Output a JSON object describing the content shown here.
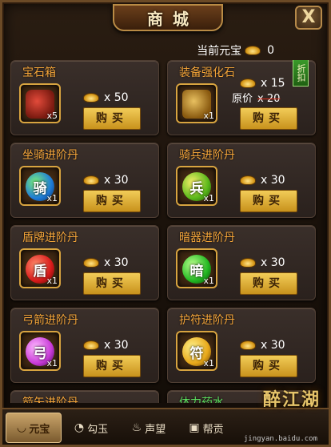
{
  "header": {
    "title": "商城",
    "close_label": "X"
  },
  "currency": {
    "label": "当前元宝",
    "value": "0"
  },
  "buy_label": "购买",
  "items": [
    {
      "name": "宝石箱",
      "orb_char": "",
      "qty": "x5",
      "price": "x 50",
      "name_color": "orange"
    },
    {
      "name": "装备强化石",
      "orb_char": "",
      "qty": "x1",
      "price": "x 15",
      "original_price_label": "原价",
      "original_price": "x 20",
      "discount_tag": "折扣",
      "name_color": "orange"
    },
    {
      "name": "坐骑进阶丹",
      "orb_char": "骑",
      "qty": "x1",
      "price": "x 30",
      "name_color": "orange"
    },
    {
      "name": "骑兵进阶丹",
      "orb_char": "兵",
      "qty": "x1",
      "price": "x 30",
      "name_color": "orange"
    },
    {
      "name": "盾牌进阶丹",
      "orb_char": "盾",
      "qty": "x1",
      "price": "x 30",
      "name_color": "orange"
    },
    {
      "name": "暗器进阶丹",
      "orb_char": "暗",
      "qty": "x1",
      "price": "x 30",
      "name_color": "orange"
    },
    {
      "name": "弓箭进阶丹",
      "orb_char": "弓",
      "qty": "x1",
      "price": "x 30",
      "name_color": "orange"
    },
    {
      "name": "护符进阶丹",
      "orb_char": "符",
      "qty": "x1",
      "price": "x 30",
      "name_color": "orange"
    },
    {
      "name": "箭矢进阶丹",
      "name_color": "orange"
    },
    {
      "name": "体力药水",
      "name_color": "green"
    }
  ],
  "tabs": [
    {
      "label": "元宝",
      "icon": "ingot-icon",
      "glyph": "◡"
    },
    {
      "label": "勾玉",
      "icon": "jade-icon",
      "glyph": "◔"
    },
    {
      "label": "声望",
      "icon": "flame-icon",
      "glyph": "♨"
    },
    {
      "label": "帮贡",
      "icon": "guild-icon",
      "glyph": "▣"
    }
  ],
  "brand": "醉江湖",
  "watermark": "jingyan.baidu.com",
  "colors": {
    "accent": "#f4a53a",
    "button": "#e2b440",
    "green_text": "#5ee060",
    "discount_tag": "#2f7f1f"
  }
}
